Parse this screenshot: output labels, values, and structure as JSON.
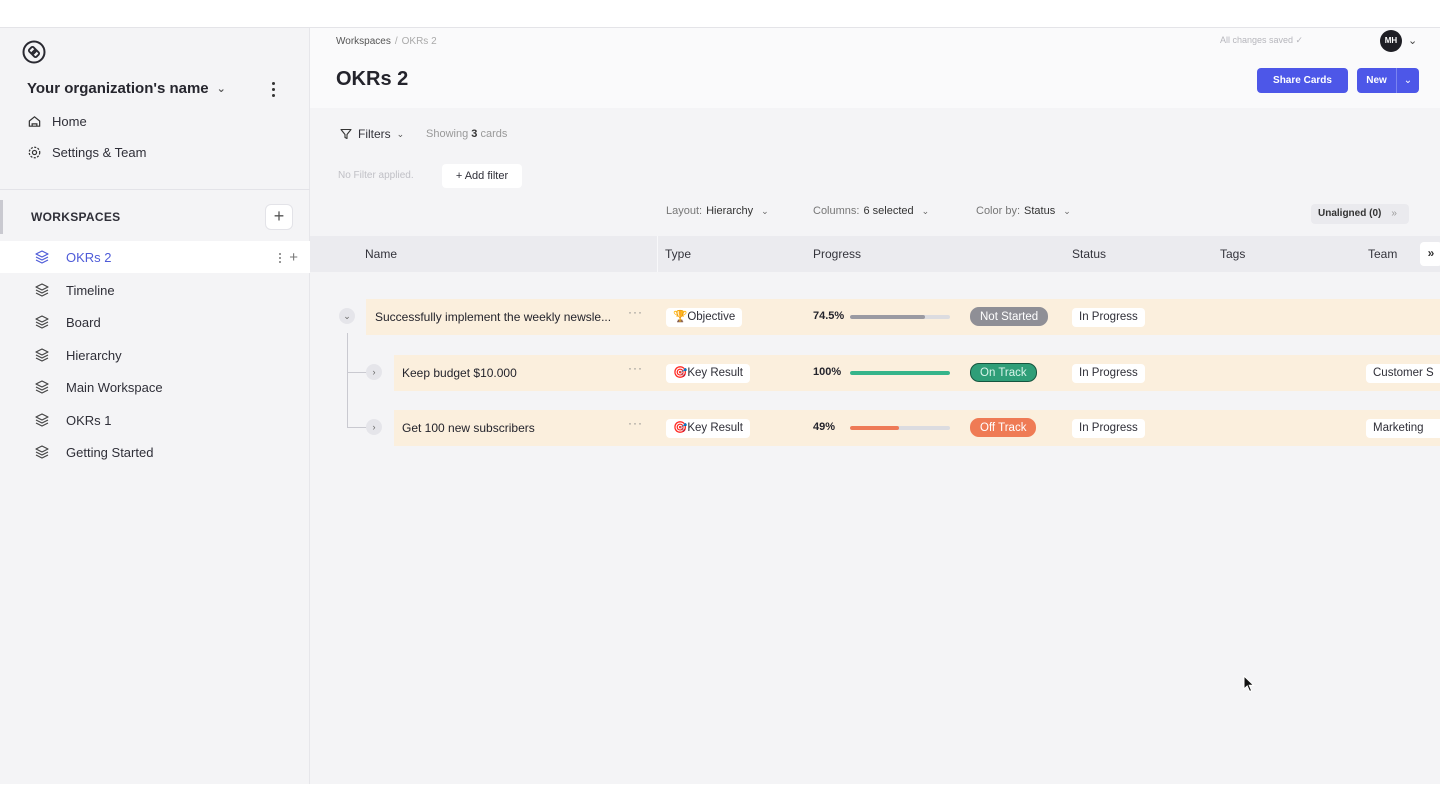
{
  "sidebar": {
    "org_name": "Your organization's name",
    "nav": [
      {
        "label": "Home",
        "icon": "home-icon"
      },
      {
        "label": "Settings & Team",
        "icon": "gear-icon"
      }
    ],
    "workspaces_title": "WORKSPACES",
    "workspaces": [
      {
        "label": "OKRs 2",
        "active": true
      },
      {
        "label": "Timeline"
      },
      {
        "label": "Board"
      },
      {
        "label": "Hierarchy"
      },
      {
        "label": "Main Workspace"
      },
      {
        "label": "OKRs 1"
      },
      {
        "label": "Getting Started"
      }
    ]
  },
  "header": {
    "breadcrumb": [
      "Workspaces",
      "OKRs 2"
    ],
    "title": "OKRs 2",
    "saved_status": "All changes saved ✓",
    "avatar_initials": "MH",
    "share_label": "Share Cards",
    "new_label": "New"
  },
  "toolbar": {
    "filters_label": "Filters",
    "showing_prefix": "Showing",
    "showing_count": "3",
    "showing_suffix": "cards",
    "no_filter": "No Filter applied.",
    "add_filter": "+ Add filter",
    "layout_label": "Layout:",
    "layout_value": "Hierarchy",
    "columns_label": "Columns:",
    "columns_value": "6 selected",
    "color_label": "Color by:",
    "color_value": "Status",
    "unaligned": "Unaligned (0)"
  },
  "table": {
    "columns": [
      "Name",
      "Type",
      "Progress",
      "Status",
      "Tags",
      "Team"
    ],
    "rows": [
      {
        "name": "Successfully implement the weekly newsle...",
        "type": "🏆Objective",
        "progress_text": "74.5%",
        "progress": 0.745,
        "status": "Not Started",
        "status_progress": "In Progress",
        "team": "",
        "bar_color": "#9a9aa2",
        "badge_bg": "#8f8f96",
        "badge_fg": "#ffffff",
        "badge_border": "#8f8f96"
      },
      {
        "name": "Keep budget $10.000",
        "type": "🎯Key Result",
        "progress_text": "100%",
        "progress": 1.0,
        "status": "On Track",
        "status_progress": "In Progress",
        "team": "Customer S",
        "bar_color": "#35b48a",
        "badge_bg": "#2f9e78",
        "badge_fg": "#d8f4ea",
        "badge_border": "#15553f"
      },
      {
        "name": "Get 100 new subscribers",
        "type": "🎯Key Result",
        "progress_text": "49%",
        "progress": 0.49,
        "status": "Off Track",
        "status_progress": "In Progress",
        "team": "Marketing",
        "bar_color": "#ee7a57",
        "badge_bg": "#ef7b55",
        "badge_fg": "#ffffff",
        "badge_border": "#ef7b55"
      }
    ]
  },
  "colors": {
    "accent": "#4d57e8",
    "row_bg": "#fbefdd",
    "active_ws": "#4e5bd8"
  }
}
